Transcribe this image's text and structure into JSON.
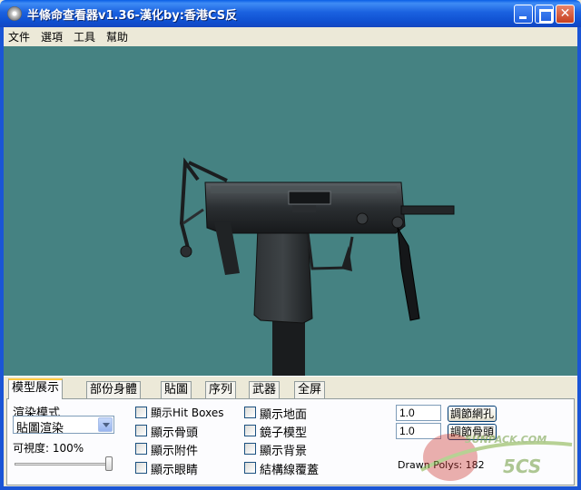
{
  "window": {
    "title": "半條命查看器v1.36-漢化by:香港CS反"
  },
  "menu": [
    "文件",
    "選項",
    "工具",
    "幫助"
  ],
  "tabs": [
    "模型展示",
    "部份身體",
    "貼圖",
    "序列",
    "武器",
    "全屏"
  ],
  "render": {
    "mode_label": "渲染模式",
    "mode_value": "貼圖渲染",
    "visibility_label": "可視度: 100%",
    "visibility": 1.0
  },
  "checkboxes": [
    {
      "label": "顯示Hit Boxes",
      "checked": false
    },
    {
      "label": "顯示骨頭",
      "checked": false
    },
    {
      "label": "顯示附件",
      "checked": false
    },
    {
      "label": "顯示眼睛",
      "checked": false
    },
    {
      "label": "顯示地面",
      "checked": false
    },
    {
      "label": "鏡子模型",
      "checked": false
    },
    {
      "label": "顯示背景",
      "checked": false
    },
    {
      "label": "結構線覆蓋",
      "checked": false
    }
  ],
  "adjust": {
    "grid_value": "1.0",
    "grid_button": "調節網孔",
    "bone_value": "1.0",
    "bone_button": "調節骨頭"
  },
  "drawn_polys": "Drawn Polys: 182",
  "watermark": {
    "top": "5UNPACK.COM",
    "bottom": "5CS"
  },
  "colors": {
    "viewport_bg": "#458282",
    "titlebar": "#0f4fd0",
    "panel_bg": "#ece9d8"
  }
}
